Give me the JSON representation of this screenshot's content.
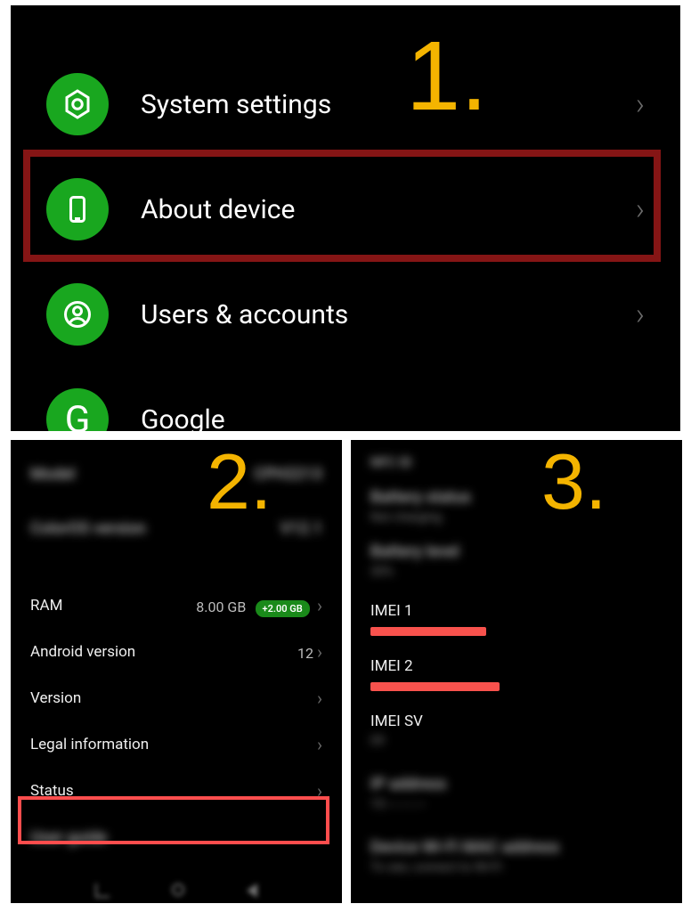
{
  "annotations": {
    "step1": "1.",
    "step2": "2.",
    "step3": "3."
  },
  "panel1": {
    "rows": [
      {
        "id": "system-settings",
        "label": "System settings"
      },
      {
        "id": "about-device",
        "label": "About device"
      },
      {
        "id": "users-accounts",
        "label": "Users & accounts"
      },
      {
        "id": "google",
        "label": "Google"
      }
    ]
  },
  "panel2": {
    "blurred_top": [
      {
        "label": "Model",
        "value": "CPH2213"
      },
      {
        "label": "ColorOS version",
        "value": "V12.1"
      }
    ],
    "rows": [
      {
        "id": "ram",
        "label": "RAM",
        "value": "8.00 GB",
        "badge": "+2.00 GB"
      },
      {
        "id": "android",
        "label": "Android version",
        "value": "12"
      },
      {
        "id": "version",
        "label": "Version",
        "value": ""
      },
      {
        "id": "legal",
        "label": "Legal information",
        "value": ""
      },
      {
        "id": "status",
        "label": "Status",
        "value": ""
      }
    ],
    "blurred_bottom_label": "User guide"
  },
  "panel3": {
    "blurred_top": [
      "NFC ID",
      "Battery status",
      "Not charging",
      "Battery level",
      "30%"
    ],
    "items": [
      {
        "id": "imei1",
        "label": "IMEI 1",
        "redacted": true,
        "redact_w": 130
      },
      {
        "id": "imei2",
        "label": "IMEI 2",
        "redacted": true,
        "redact_w": 145
      },
      {
        "id": "imeisv",
        "label": "IMEI SV",
        "redacted": false,
        "sub_blur": "09"
      }
    ],
    "blurred_bottom": [
      {
        "label": "IP address",
        "sub": "10.---.---.---"
      },
      {
        "label": "Device Wi-Fi MAC address",
        "sub": "To see, connect to Wi-Fi"
      }
    ]
  }
}
